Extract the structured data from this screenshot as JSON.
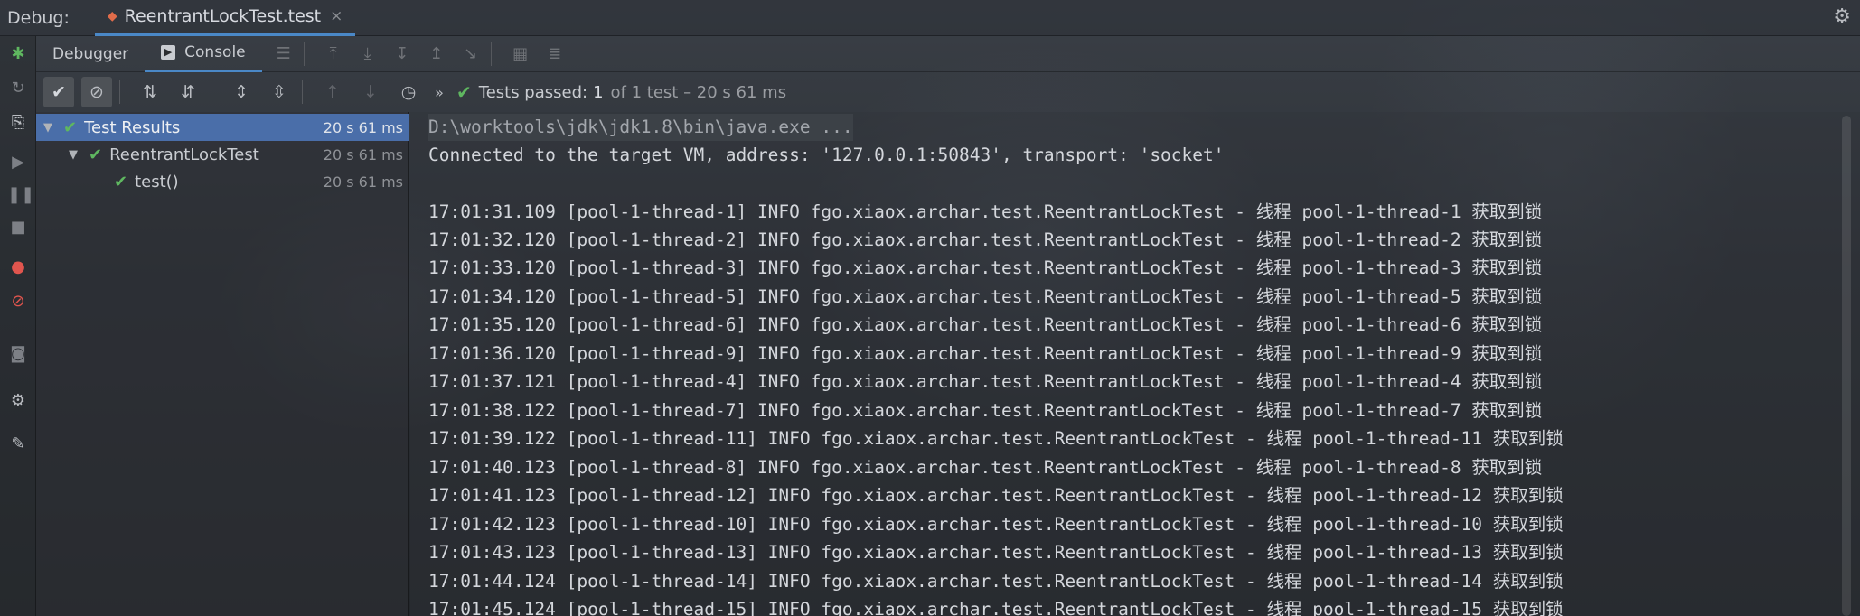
{
  "window": {
    "debug_label": "Debug:",
    "run_tab": "ReentrantLockTest.test",
    "close_glyph": "×"
  },
  "subtabs": {
    "debugger": "Debugger",
    "console": "Console"
  },
  "test_status": {
    "label": "Tests passed:",
    "count": "1",
    "detail": "of 1 test – 20 s 61 ms"
  },
  "tree": [
    {
      "label": "Test Results",
      "time": "20 s 61 ms"
    },
    {
      "label": "ReentrantLockTest",
      "time": "20 s 61 ms"
    },
    {
      "label": "test()",
      "time": "20 s 61 ms"
    }
  ],
  "console": {
    "lines": [
      "D:\\worktools\\jdk\\jdk1.8\\bin\\java.exe ...",
      "Connected to the target VM, address: '127.0.0.1:50843', transport: 'socket'",
      "",
      "17:01:31.109 [pool-1-thread-1] INFO fgo.xiaox.archar.test.ReentrantLockTest - 线程 pool-1-thread-1 获取到锁",
      "17:01:32.120 [pool-1-thread-2] INFO fgo.xiaox.archar.test.ReentrantLockTest - 线程 pool-1-thread-2 获取到锁",
      "17:01:33.120 [pool-1-thread-3] INFO fgo.xiaox.archar.test.ReentrantLockTest - 线程 pool-1-thread-3 获取到锁",
      "17:01:34.120 [pool-1-thread-5] INFO fgo.xiaox.archar.test.ReentrantLockTest - 线程 pool-1-thread-5 获取到锁",
      "17:01:35.120 [pool-1-thread-6] INFO fgo.xiaox.archar.test.ReentrantLockTest - 线程 pool-1-thread-6 获取到锁",
      "17:01:36.120 [pool-1-thread-9] INFO fgo.xiaox.archar.test.ReentrantLockTest - 线程 pool-1-thread-9 获取到锁",
      "17:01:37.121 [pool-1-thread-4] INFO fgo.xiaox.archar.test.ReentrantLockTest - 线程 pool-1-thread-4 获取到锁",
      "17:01:38.122 [pool-1-thread-7] INFO fgo.xiaox.archar.test.ReentrantLockTest - 线程 pool-1-thread-7 获取到锁",
      "17:01:39.122 [pool-1-thread-11] INFO fgo.xiaox.archar.test.ReentrantLockTest - 线程 pool-1-thread-11 获取到锁",
      "17:01:40.123 [pool-1-thread-8] INFO fgo.xiaox.archar.test.ReentrantLockTest - 线程 pool-1-thread-8 获取到锁",
      "17:01:41.123 [pool-1-thread-12] INFO fgo.xiaox.archar.test.ReentrantLockTest - 线程 pool-1-thread-12 获取到锁",
      "17:01:42.123 [pool-1-thread-10] INFO fgo.xiaox.archar.test.ReentrantLockTest - 线程 pool-1-thread-10 获取到锁",
      "17:01:43.123 [pool-1-thread-13] INFO fgo.xiaox.archar.test.ReentrantLockTest - 线程 pool-1-thread-13 获取到锁",
      "17:01:44.124 [pool-1-thread-14] INFO fgo.xiaox.archar.test.ReentrantLockTest - 线程 pool-1-thread-14 获取到锁",
      "17:01:45.124 [pool-1-thread-15] INFO fgo.xiaox.archar.test.ReentrantLockTest - 线程 pool-1-thread-15 获取到锁"
    ]
  },
  "colors": {
    "accent": "#4a88c7",
    "pass_green": "#5fb760",
    "selection": "#4a6ea9"
  },
  "icons": {
    "toolbar_left": [
      "debug-bug-icon",
      "rerun-icon",
      "restore-layout-icon",
      "resume-icon",
      "pause-icon",
      "stop-icon",
      "view-breakpoints-icon",
      "mute-breakpoints-icon",
      "camera-icon",
      "settings-icon",
      "pin-icon"
    ],
    "test_toolbar": [
      "show-passed-icon",
      "show-ignored-icon",
      "sort-alpha-icon",
      "sort-duration-icon",
      "expand-all-icon",
      "collapse-all-icon",
      "previous-icon",
      "next-icon",
      "history-icon",
      "more-icon"
    ]
  }
}
